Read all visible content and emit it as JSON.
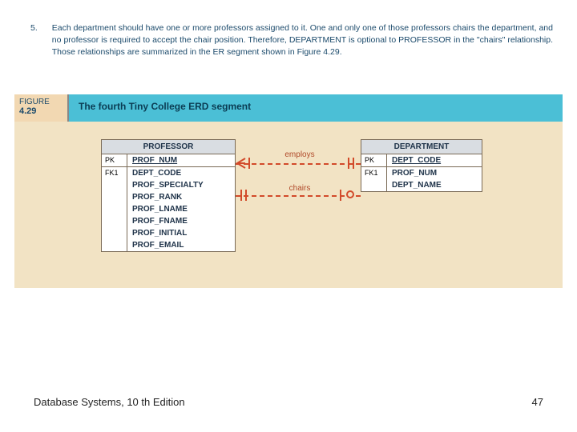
{
  "paragraph": {
    "number": "5.",
    "text": "Each department should have one or more professors assigned to it. One and only one of those professors chairs the department, and no professor is required to accept the chair position. Therefore, DEPARTMENT is optional to PROFESSOR in the \"chairs\" relationship. Those relationships are summarized in the ER segment shown in Figure 4.29."
  },
  "figure": {
    "label_word": "FIGURE",
    "label_num": "4.29",
    "caption": "The fourth Tiny College ERD segment"
  },
  "entities": {
    "professor": {
      "title": "PROFESSOR",
      "pk_label": "PK",
      "pk_field": "PROF_NUM",
      "fk_label": "FK1",
      "fields": [
        "DEPT_CODE",
        "PROF_SPECIALTY",
        "PROF_RANK",
        "PROF_LNAME",
        "PROF_FNAME",
        "PROF_INITIAL",
        "PROF_EMAIL"
      ]
    },
    "department": {
      "title": "DEPARTMENT",
      "pk_label": "PK",
      "pk_field": "DEPT_CODE",
      "fk_label": "FK1",
      "fields": [
        "PROF_NUM",
        "DEPT_NAME"
      ]
    }
  },
  "relations": {
    "employs": "employs",
    "chairs": "chairs"
  },
  "footer": {
    "left": "Database Systems, 10 th Edition",
    "right": "47"
  }
}
